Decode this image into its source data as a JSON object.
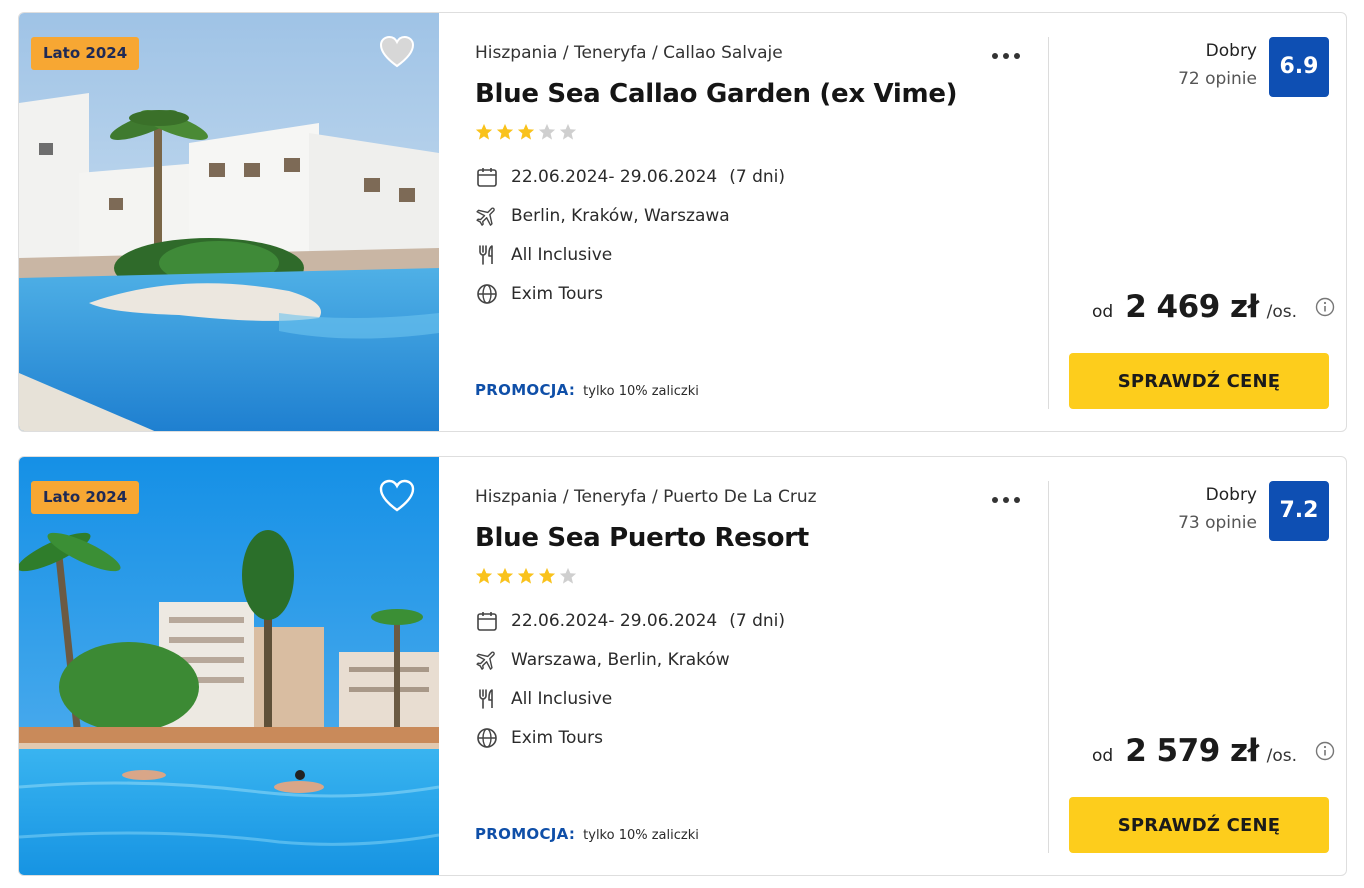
{
  "offers": [
    {
      "badge": "Lato 2024",
      "breadcrumb": "Hiszpania / Teneryfa / Callao Salvaje",
      "name": "Blue Sea Callao Garden (ex Vime)",
      "stars": 3,
      "dates": "22.06.2024- 29.06.2024",
      "duration": "(7 dni)",
      "departures": "Berlin, Kraków, Warszawa",
      "board": "All Inclusive",
      "operator": "Exim Tours",
      "promo_label": "PROMOCJA:",
      "promo_text": "tylko 10% zaliczki",
      "rating_label": "Dobry",
      "reviews": "72 opinie",
      "score": "6.9",
      "price_from": "od",
      "price": "2 469 zł",
      "price_per": "/os.",
      "cta": "SPRAWDŹ CENĘ",
      "favorite": false
    },
    {
      "badge": "Lato 2024",
      "breadcrumb": "Hiszpania / Teneryfa / Puerto De La Cruz",
      "name": "Blue Sea Puerto Resort",
      "stars": 4,
      "dates": "22.06.2024- 29.06.2024",
      "duration": "(7 dni)",
      "departures": "Warszawa, Berlin, Kraków",
      "board": "All Inclusive",
      "operator": "Exim Tours",
      "promo_label": "PROMOCJA:",
      "promo_text": "tylko 10% zaliczki",
      "rating_label": "Dobry",
      "reviews": "73 opinie",
      "score": "7.2",
      "price_from": "od",
      "price": "2 579 zł",
      "price_per": "/os.",
      "cta": "SPRAWDŹ CENĘ",
      "favorite": false
    }
  ],
  "colors": {
    "badge": "#f7a733",
    "score": "#0e4fb3",
    "cta": "#fdcd1c",
    "promo": "#0f4fa8",
    "star_on": "#f9c21b",
    "star_off": "#cfcfcf"
  },
  "icons": {
    "favorite": "heart-icon",
    "more": "more-dots-icon",
    "dates": "calendar-icon",
    "departures": "plane-icon",
    "board": "cutlery-icon",
    "operator": "globe-icon",
    "info": "info-icon",
    "rating": "star-icon"
  }
}
